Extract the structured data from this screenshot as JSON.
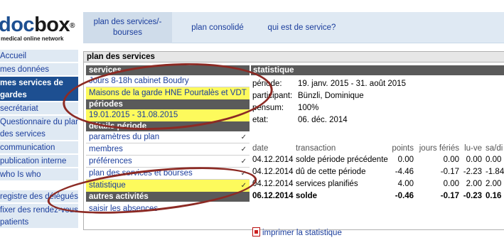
{
  "logo": {
    "word_part1": "doc",
    "word_part2": "box",
    "reg": "®",
    "tagline": "medical online network"
  },
  "topnav": {
    "tabs": [
      {
        "label": "plan des services/- bourses"
      },
      {
        "label": "plan consolidé"
      },
      {
        "label": "qui est de service?"
      }
    ]
  },
  "sidebar": {
    "items": [
      {
        "label": "Accueil"
      },
      {
        "label": "mes données"
      },
      {
        "label": "mes services de"
      },
      {
        "label": "gardes"
      },
      {
        "label": "secrétariat"
      },
      {
        "label": "Questionnaire du plan"
      },
      {
        "label": "des services"
      },
      {
        "label": "communication"
      },
      {
        "label": "publication interne"
      },
      {
        "label": "who Is who"
      },
      {
        "label": "registre des délégués"
      },
      {
        "label": "fixer des rendez-vous"
      },
      {
        "label": "patients"
      }
    ]
  },
  "panel": {
    "title": "plan des services",
    "services_header": "services",
    "services": [
      "Jours 8-18h cabinet Boudry",
      "Maisons de la garde HNE Pourtalès et VDT"
    ],
    "periods_header": "périodes",
    "period": "19.01.2015 - 31.08.2015",
    "details_header": "détails période",
    "details": [
      {
        "label": "paramètres du plan",
        "check": "✓"
      },
      {
        "label": "membres",
        "check": "✓"
      },
      {
        "label": "préférences",
        "check": "✓"
      },
      {
        "label": "plan des services et bourses",
        "check": "✓"
      },
      {
        "label": "statistique",
        "check": "✓"
      }
    ],
    "other_header": "autres activités",
    "other": [
      "saisir les absences"
    ]
  },
  "statistics": {
    "header": "statistique",
    "info": [
      {
        "key": "période:",
        "value": "19. janv. 2015 - 31. août 2015"
      },
      {
        "key": "participant:",
        "value": "Bünzli, Dominique"
      },
      {
        "key": "pensum:",
        "value": "100%"
      },
      {
        "key": "etat:",
        "value": "06. déc. 2014"
      }
    ],
    "columns": [
      "date",
      "transaction",
      "points",
      "jours fériés",
      "lu-ve",
      "sa/di"
    ],
    "rows": [
      {
        "date": "04.12.2014",
        "transaction": "solde période précédente",
        "points": "0.00",
        "jf": "0.00",
        "luve": "0.00",
        "sadi": "0.00"
      },
      {
        "date": "04.12.2014",
        "transaction": "dû de cette période",
        "points": "-4.46",
        "jf": "-0.17",
        "luve": "-2.23",
        "sadi": "-1.84"
      },
      {
        "date": "04.12.2014",
        "transaction": "services planifiés",
        "points": "4.00",
        "jf": "0.00",
        "luve": "2.00",
        "sadi": "2.00"
      },
      {
        "date": "06.12.2014",
        "transaction": "solde",
        "points": "-0.46",
        "jf": "-0.17",
        "luve": "-0.23",
        "sadi": "0.16"
      }
    ],
    "print_label": "imprimer la statistique"
  },
  "colors": {
    "sidebar_bg": "#dfe9f3",
    "active_bg": "#1d4f91",
    "highlight": "#fdfa5c",
    "section_header": "#5a5a5a",
    "annotation": "#8c2a24"
  }
}
